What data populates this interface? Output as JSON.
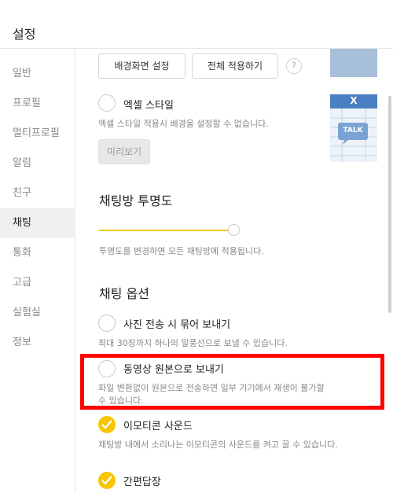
{
  "window": {
    "title": "설정"
  },
  "sidebar": {
    "items": [
      {
        "label": "일반"
      },
      {
        "label": "프로필"
      },
      {
        "label": "멀티프로필"
      },
      {
        "label": "알림"
      },
      {
        "label": "친구"
      },
      {
        "label": "채팅",
        "active": true
      },
      {
        "label": "통화"
      },
      {
        "label": "고급"
      },
      {
        "label": "실험실"
      },
      {
        "label": "정보"
      }
    ]
  },
  "background": {
    "set_bg_button": "배경화면 설정",
    "apply_all_button": "전체 적용하기",
    "help": "?",
    "excel_style_label": "엑셀 스타일",
    "excel_style_desc": "엑셀 스타일 적용시 배경을 설정할 수 없습니다.",
    "preview_button": "미리보기",
    "excel_thumb_x": "X",
    "excel_thumb_talk": "TALK"
  },
  "transparency": {
    "title": "채팅방 투명도",
    "desc": "투명도를 변경하면 모든 채팅방에 적용됩니다.",
    "value": 1.0
  },
  "chat_options": {
    "title": "채팅 옵션",
    "items": [
      {
        "label": "사진 전송 시 묶어 보내기",
        "desc": "최대 30장까지 하나의 말풍선으로 보낼 수 있습니다.",
        "checked": false
      },
      {
        "label": "동영상 원본으로 보내기",
        "desc_line1": "파일 변환없이 원본으로 전송하면 일부 기기에서 재생이 불가할",
        "desc_line2": "수 있습니다.",
        "checked": false
      },
      {
        "label": "이모티콘 사운드",
        "desc": "채팅방 내에서 소리나는 이모티콘의 사운드를 켜고 끌 수 있습니다.",
        "checked": true
      },
      {
        "label": "간편답장",
        "checked": true
      }
    ]
  },
  "colors": {
    "accent": "#f7c600",
    "highlight": "#ff0000",
    "excel_blue": "#4a7fc1"
  }
}
